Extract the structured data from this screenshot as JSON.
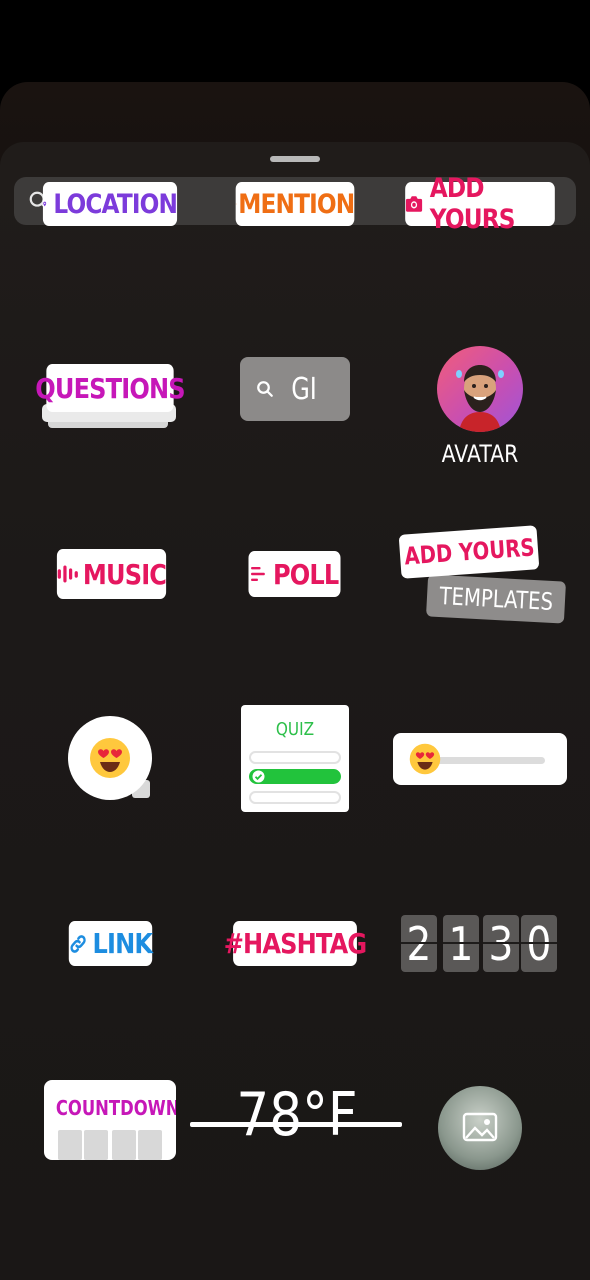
{
  "search": {
    "placeholder": "Search"
  },
  "stickers": {
    "location": "LOCATION",
    "mention": "MENTION",
    "add_yours": "ADD YOURS",
    "questions": "QUESTIONS",
    "gif": "GI",
    "avatar": "AVATAR",
    "music": "MUSIC",
    "poll": "POLL",
    "add_yours_templates_top": "ADD YOURS",
    "add_yours_templates_bottom": "TEMPLATES",
    "quiz": "QUIZ",
    "link": "LINK",
    "hashtag": "#HASHTAG",
    "clock_digits": [
      "2",
      "1",
      "3",
      "0"
    ],
    "countdown": "COUNTDOWN",
    "temperature": "78°F"
  },
  "colors": {
    "location": "#7c3bdb",
    "mention": "#ef6e14",
    "pink": "#e5175f",
    "questions": "#c617b8",
    "link": "#1d8de0",
    "quiz": "#2dbf4a"
  }
}
